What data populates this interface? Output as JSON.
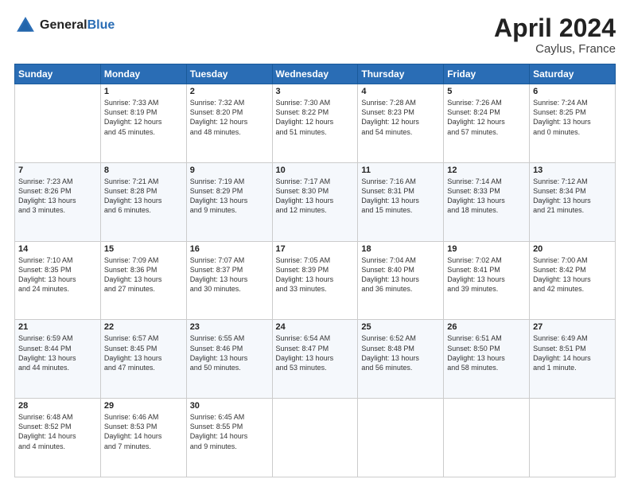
{
  "header": {
    "logo_line1": "General",
    "logo_line2": "Blue",
    "title": "April 2024",
    "subtitle": "Caylus, France"
  },
  "weekdays": [
    "Sunday",
    "Monday",
    "Tuesday",
    "Wednesday",
    "Thursday",
    "Friday",
    "Saturday"
  ],
  "weeks": [
    [
      {
        "day": "",
        "info": ""
      },
      {
        "day": "1",
        "info": "Sunrise: 7:33 AM\nSunset: 8:19 PM\nDaylight: 12 hours\nand 45 minutes."
      },
      {
        "day": "2",
        "info": "Sunrise: 7:32 AM\nSunset: 8:20 PM\nDaylight: 12 hours\nand 48 minutes."
      },
      {
        "day": "3",
        "info": "Sunrise: 7:30 AM\nSunset: 8:22 PM\nDaylight: 12 hours\nand 51 minutes."
      },
      {
        "day": "4",
        "info": "Sunrise: 7:28 AM\nSunset: 8:23 PM\nDaylight: 12 hours\nand 54 minutes."
      },
      {
        "day": "5",
        "info": "Sunrise: 7:26 AM\nSunset: 8:24 PM\nDaylight: 12 hours\nand 57 minutes."
      },
      {
        "day": "6",
        "info": "Sunrise: 7:24 AM\nSunset: 8:25 PM\nDaylight: 13 hours\nand 0 minutes."
      }
    ],
    [
      {
        "day": "7",
        "info": "Sunrise: 7:23 AM\nSunset: 8:26 PM\nDaylight: 13 hours\nand 3 minutes."
      },
      {
        "day": "8",
        "info": "Sunrise: 7:21 AM\nSunset: 8:28 PM\nDaylight: 13 hours\nand 6 minutes."
      },
      {
        "day": "9",
        "info": "Sunrise: 7:19 AM\nSunset: 8:29 PM\nDaylight: 13 hours\nand 9 minutes."
      },
      {
        "day": "10",
        "info": "Sunrise: 7:17 AM\nSunset: 8:30 PM\nDaylight: 13 hours\nand 12 minutes."
      },
      {
        "day": "11",
        "info": "Sunrise: 7:16 AM\nSunset: 8:31 PM\nDaylight: 13 hours\nand 15 minutes."
      },
      {
        "day": "12",
        "info": "Sunrise: 7:14 AM\nSunset: 8:33 PM\nDaylight: 13 hours\nand 18 minutes."
      },
      {
        "day": "13",
        "info": "Sunrise: 7:12 AM\nSunset: 8:34 PM\nDaylight: 13 hours\nand 21 minutes."
      }
    ],
    [
      {
        "day": "14",
        "info": "Sunrise: 7:10 AM\nSunset: 8:35 PM\nDaylight: 13 hours\nand 24 minutes."
      },
      {
        "day": "15",
        "info": "Sunrise: 7:09 AM\nSunset: 8:36 PM\nDaylight: 13 hours\nand 27 minutes."
      },
      {
        "day": "16",
        "info": "Sunrise: 7:07 AM\nSunset: 8:37 PM\nDaylight: 13 hours\nand 30 minutes."
      },
      {
        "day": "17",
        "info": "Sunrise: 7:05 AM\nSunset: 8:39 PM\nDaylight: 13 hours\nand 33 minutes."
      },
      {
        "day": "18",
        "info": "Sunrise: 7:04 AM\nSunset: 8:40 PM\nDaylight: 13 hours\nand 36 minutes."
      },
      {
        "day": "19",
        "info": "Sunrise: 7:02 AM\nSunset: 8:41 PM\nDaylight: 13 hours\nand 39 minutes."
      },
      {
        "day": "20",
        "info": "Sunrise: 7:00 AM\nSunset: 8:42 PM\nDaylight: 13 hours\nand 42 minutes."
      }
    ],
    [
      {
        "day": "21",
        "info": "Sunrise: 6:59 AM\nSunset: 8:44 PM\nDaylight: 13 hours\nand 44 minutes."
      },
      {
        "day": "22",
        "info": "Sunrise: 6:57 AM\nSunset: 8:45 PM\nDaylight: 13 hours\nand 47 minutes."
      },
      {
        "day": "23",
        "info": "Sunrise: 6:55 AM\nSunset: 8:46 PM\nDaylight: 13 hours\nand 50 minutes."
      },
      {
        "day": "24",
        "info": "Sunrise: 6:54 AM\nSunset: 8:47 PM\nDaylight: 13 hours\nand 53 minutes."
      },
      {
        "day": "25",
        "info": "Sunrise: 6:52 AM\nSunset: 8:48 PM\nDaylight: 13 hours\nand 56 minutes."
      },
      {
        "day": "26",
        "info": "Sunrise: 6:51 AM\nSunset: 8:50 PM\nDaylight: 13 hours\nand 58 minutes."
      },
      {
        "day": "27",
        "info": "Sunrise: 6:49 AM\nSunset: 8:51 PM\nDaylight: 14 hours\nand 1 minute."
      }
    ],
    [
      {
        "day": "28",
        "info": "Sunrise: 6:48 AM\nSunset: 8:52 PM\nDaylight: 14 hours\nand 4 minutes."
      },
      {
        "day": "29",
        "info": "Sunrise: 6:46 AM\nSunset: 8:53 PM\nDaylight: 14 hours\nand 7 minutes."
      },
      {
        "day": "30",
        "info": "Sunrise: 6:45 AM\nSunset: 8:55 PM\nDaylight: 14 hours\nand 9 minutes."
      },
      {
        "day": "",
        "info": ""
      },
      {
        "day": "",
        "info": ""
      },
      {
        "day": "",
        "info": ""
      },
      {
        "day": "",
        "info": ""
      }
    ]
  ]
}
